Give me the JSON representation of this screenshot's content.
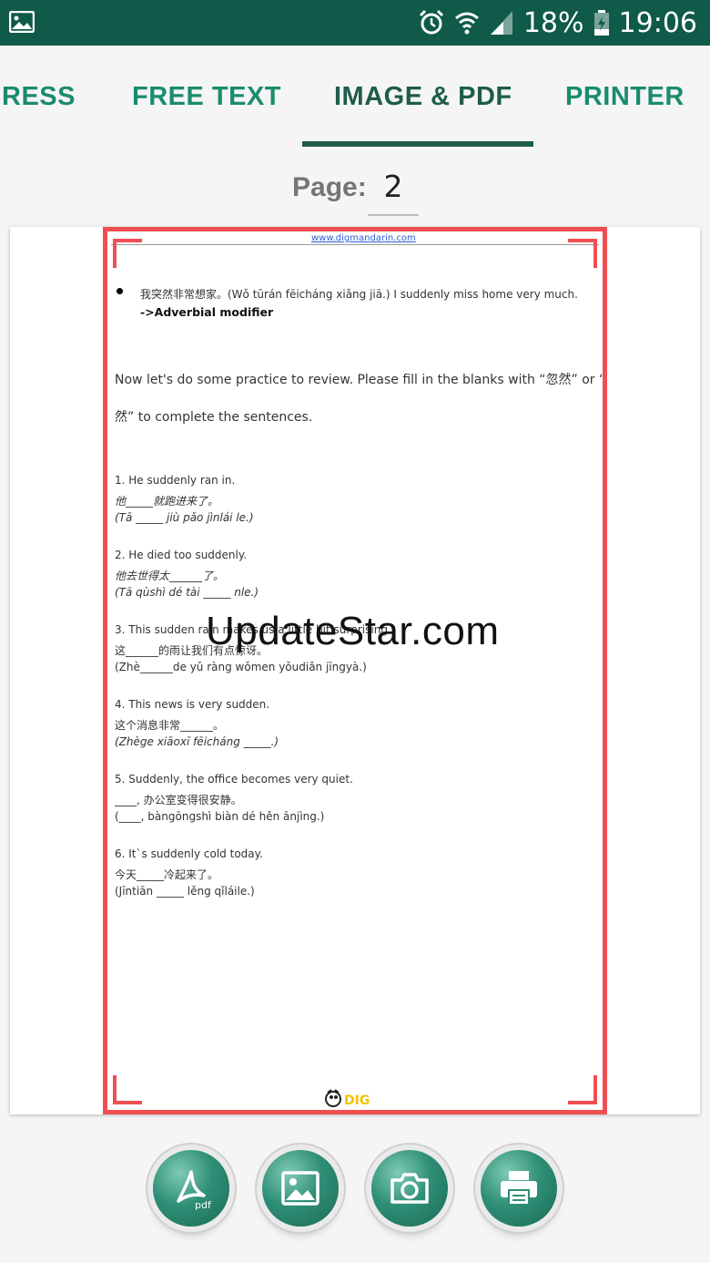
{
  "status_bar": {
    "battery_percent": "18%",
    "time": "19:06",
    "icons": [
      "gallery-icon",
      "alarm-icon",
      "wifi-icon",
      "signal-icon",
      "battery-icon"
    ]
  },
  "tabs": [
    {
      "label": "RESS",
      "active": false
    },
    {
      "label": "FREE TEXT",
      "active": false
    },
    {
      "label": "IMAGE & PDF",
      "active": true
    },
    {
      "label": "PRINTER",
      "active": false
    }
  ],
  "page": {
    "label": "Page:",
    "value": "2"
  },
  "document": {
    "url": "www.digmandarin.com",
    "example_line": "我突然非常想家。(Wǒ tūrán fēicháng xiǎng jiā.)  I suddenly miss home very much.",
    "modifier": "->Adverbial modifier",
    "intro_1": "Now let's do some practice to review. Please fill in the blanks with “忽然” or “突",
    "intro_2": "然” to complete the sentences.",
    "exercises": [
      {
        "en": "1. He suddenly ran in.",
        "zh": "他_____就跑进来了。",
        "py": "(Tā _____ jiù pǎo jìnlái le.)"
      },
      {
        "en": "2. He died too suddenly.",
        "zh": "他去世得太______了。",
        "py": "(Tā qùshì dé tài _____ nle.)"
      },
      {
        "en": "3. This sudden rain makes us a little bit surprising.",
        "zh": "这______的雨让我们有点惊讶。",
        "py": "(Zhè______de yǔ ràng wǒmen yǒudiǎn jīngyà.)"
      },
      {
        "en": "4. This news is very sudden.",
        "zh": "这个消息非常______。",
        "py": "(Zhège xiāoxī fēicháng _____.)"
      },
      {
        "en": "5. Suddenly, the office becomes very quiet.",
        "zh": "____, 办公室变得很安静。",
        "py": "(____, bàngōngshì biàn dé hěn ānjìng.)"
      },
      {
        "en": "6. It`s suddenly cold today.",
        "zh": "今天_____冷起来了。",
        "py": "(Jīntiān _____ lěng qǐláile.)"
      }
    ],
    "logo_text": "DIG"
  },
  "watermark": "UpdateStar.com",
  "bottom_buttons": [
    {
      "name": "pdf-button",
      "icon": "pdf-icon",
      "label": "pdf"
    },
    {
      "name": "image-button",
      "icon": "image-icon"
    },
    {
      "name": "camera-button",
      "icon": "camera-icon"
    },
    {
      "name": "printer-button",
      "icon": "printer-icon"
    }
  ],
  "colors": {
    "status_bar": "#0f5a48",
    "tab_text": "#1a8c6d",
    "tab_active": "#1f5c4b",
    "crop_frame": "#ef4f52",
    "button_green": "#2f8f76"
  }
}
